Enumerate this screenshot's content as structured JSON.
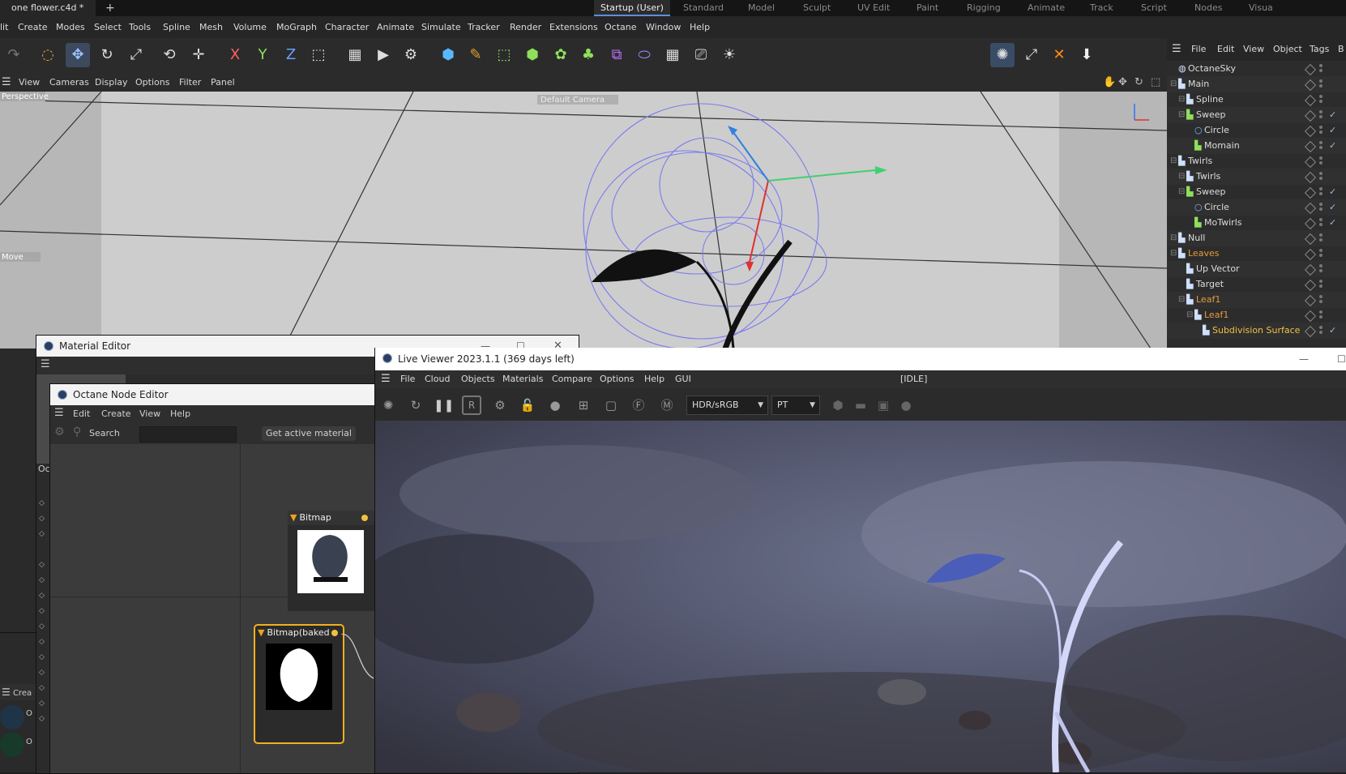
{
  "tabs": {
    "file": "one flower.c4d *",
    "plus": "+"
  },
  "layouts": [
    "Startup (User)",
    "Standard",
    "Model",
    "Sculpt",
    "UV Edit",
    "Paint",
    "Rigging",
    "Animate",
    "Track",
    "Script",
    "Nodes",
    "Visua"
  ],
  "menu": [
    "lit",
    "Create",
    "Modes",
    "Select",
    "Tools",
    "Spline",
    "Mesh",
    "Volume",
    "MoGraph",
    "Character",
    "Animate",
    "Simulate",
    "Tracker",
    "Render",
    "Extensions",
    "Octane",
    "Window",
    "Help"
  ],
  "toolbar": {
    "x_label": "X",
    "y_label": "Y",
    "z_label": "Z"
  },
  "viewport": {
    "menu": [
      "View",
      "Cameras",
      "Display",
      "Options",
      "Filter",
      "Panel"
    ],
    "projection": "Perspective",
    "camera": "Default Camera",
    "tool": "Move"
  },
  "objects_panel": {
    "menu": [
      "File",
      "Edit",
      "View",
      "Object",
      "Tags",
      "B"
    ],
    "items": [
      {
        "name": "OctaneSky",
        "depth": 0,
        "color": "#dcdcdc"
      },
      {
        "name": "Main",
        "depth": 0,
        "color": "#dcdcdc"
      },
      {
        "name": "Spline",
        "depth": 1,
        "color": "#dcdcdc"
      },
      {
        "name": "Sweep",
        "depth": 1,
        "color": "#dcdcdc"
      },
      {
        "name": "Circle",
        "depth": 2,
        "color": "#dcdcdc"
      },
      {
        "name": "Momain",
        "depth": 2,
        "color": "#dcdcdc"
      },
      {
        "name": "Twirls",
        "depth": 0,
        "color": "#dcdcdc"
      },
      {
        "name": "Twirls",
        "depth": 1,
        "color": "#dcdcdc"
      },
      {
        "name": "Sweep",
        "depth": 1,
        "color": "#dcdcdc"
      },
      {
        "name": "Circle",
        "depth": 2,
        "color": "#dcdcdc"
      },
      {
        "name": "MoTwirls",
        "depth": 2,
        "color": "#dcdcdc"
      },
      {
        "name": "Null",
        "depth": 0,
        "color": "#dcdcdc"
      },
      {
        "name": "Leaves",
        "depth": 0,
        "color": "#e89a3c"
      },
      {
        "name": "Up Vector",
        "depth": 1,
        "color": "#dcdcdc"
      },
      {
        "name": "Target",
        "depth": 1,
        "color": "#dcdcdc"
      },
      {
        "name": "Leaf1",
        "depth": 1,
        "color": "#e89a3c"
      },
      {
        "name": "Leaf1",
        "depth": 2,
        "color": "#e89a3c"
      },
      {
        "name": "Subdivision Surface",
        "depth": 3,
        "color": "#f0c040"
      }
    ]
  },
  "material_editor": {
    "title": "Material Editor",
    "side_label": "Oc"
  },
  "left_panel": {
    "create_label": "Crea",
    "mat_labels": [
      "O",
      "O"
    ]
  },
  "node_editor": {
    "title": "Octane Node Editor",
    "menu": [
      "Edit",
      "Create",
      "View",
      "Help"
    ],
    "search_label": "Search",
    "search_value": "",
    "get_active": "Get active material",
    "nodes": [
      "Bitmap",
      "Bitmap(baked"
    ]
  },
  "live_viewer": {
    "title": "Live Viewer 2023.1.1 (369 days left)",
    "menu": [
      "File",
      "Cloud",
      "Objects",
      "Materials",
      "Compare",
      "Options",
      "Help",
      "GUI"
    ],
    "status": "[IDLE]",
    "colorspace": "HDR/sRGB",
    "kernel": "PT"
  }
}
